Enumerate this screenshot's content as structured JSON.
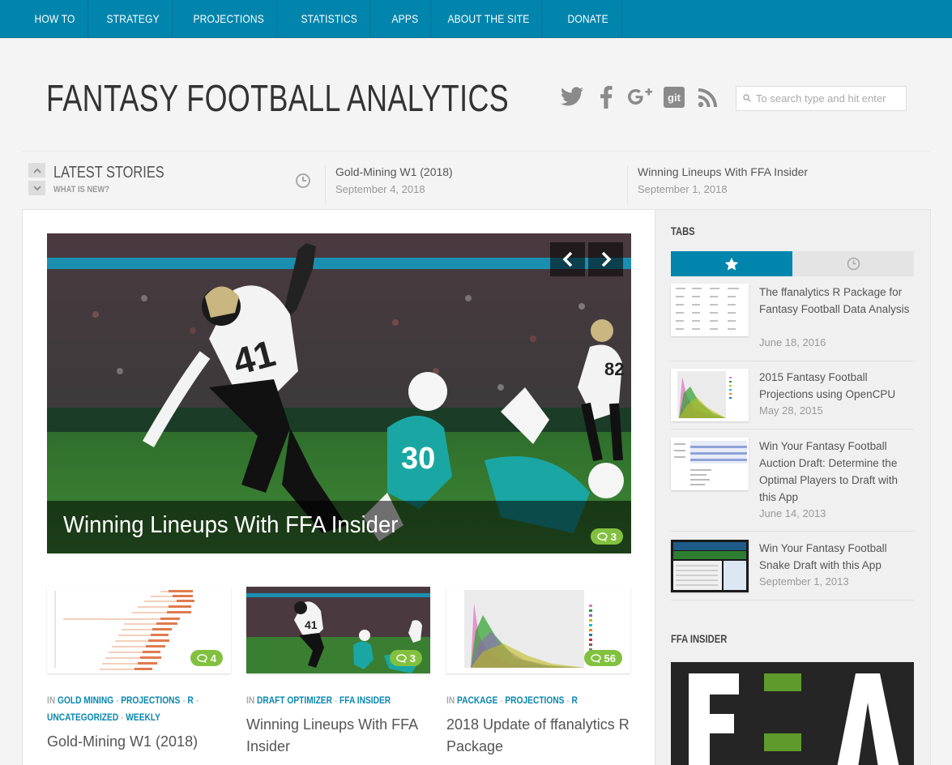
{
  "nav": {
    "items": [
      "HOW TO",
      "STRATEGY",
      "PROJECTIONS",
      "STATISTICS",
      "APPS",
      "ABOUT THE SITE",
      "DONATE"
    ]
  },
  "header": {
    "title": "FANTASY FOOTBALL ANALYTICS"
  },
  "social": [
    "twitter-icon",
    "facebook-icon",
    "google-plus-icon",
    "git-icon",
    "rss-icon"
  ],
  "search": {
    "placeholder": "To search type and hit enter"
  },
  "ticker": {
    "heading": "LATEST STORIES",
    "subheading": "WHAT IS NEW?",
    "stories": [
      {
        "title": "Gold-Mining W1 (2018)",
        "date": "September 4, 2018"
      },
      {
        "title": "Winning Lineups With FFA Insider",
        "date": "September 1, 2018"
      }
    ]
  },
  "slider": {
    "caption": "Winning Lineups With FFA Insider",
    "comments": "3"
  },
  "cards": [
    {
      "cat_prefix": "IN",
      "categories": [
        "GOLD MINING",
        "PROJECTIONS",
        "R",
        "UNCATEGORIZED",
        "WEEKLY"
      ],
      "title": "Gold-Mining W1 (2018)",
      "comments": "4"
    },
    {
      "cat_prefix": "IN",
      "categories": [
        "DRAFT OPTIMIZER",
        "FFA INSIDER"
      ],
      "title": "Winning Lineups With FFA Insider",
      "comments": "3"
    },
    {
      "cat_prefix": "IN",
      "categories": [
        "PACKAGE",
        "PROJECTIONS",
        "R"
      ],
      "title": "2018 Update of ffanalytics R Package",
      "comments": "56"
    }
  ],
  "sidebar": {
    "tabs_heading": "TABS",
    "posts": [
      {
        "title": "The ffanalytics R Package for Fantasy Football Data Analysis",
        "date": "June 18, 2016"
      },
      {
        "title": "2015 Fantasy Football Projections using OpenCPU",
        "date": "May 28, 2015"
      },
      {
        "title": "Win Your Fantasy Football Auction Draft: Determine the Optimal Players to Draft with this App",
        "date": "June 14, 2013"
      },
      {
        "title": "Win Your Fantasy Football Snake Draft with this App",
        "date": "September 1, 2013"
      }
    ],
    "insider_heading": "FFA INSIDER"
  },
  "colors": {
    "accent": "#0285ad",
    "badge": "#82c13f"
  }
}
